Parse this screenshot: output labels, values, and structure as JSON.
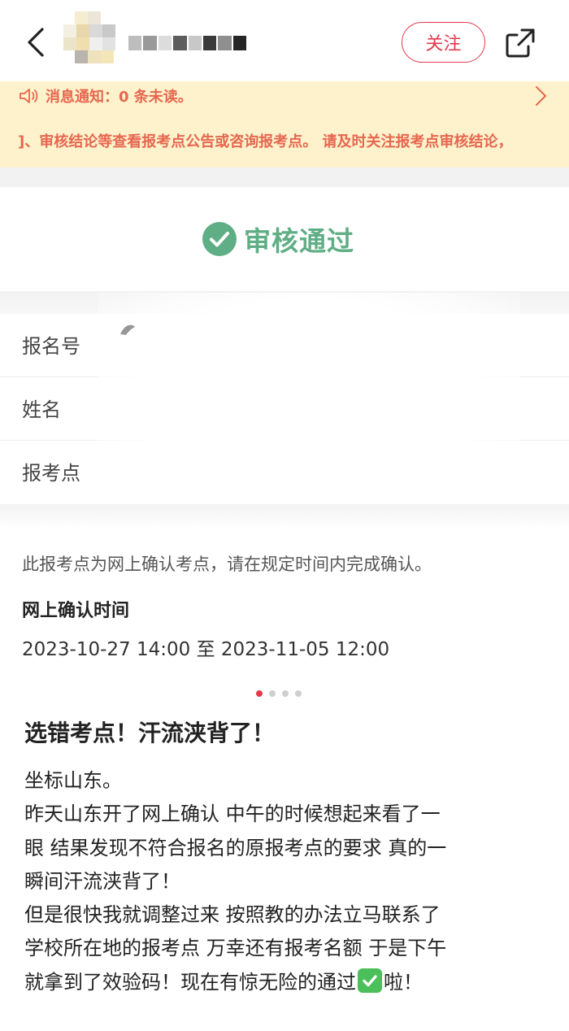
{
  "header": {
    "follow_label": "关注"
  },
  "notice": {
    "message": "消息通知：0 条未读。",
    "banner": "]、审核结论等查看报考点公告或咨询报考点。 请及时关注报考点审核结论，"
  },
  "status": {
    "text": "审核通过",
    "color": "#5fae85"
  },
  "info_rows": [
    {
      "label": "报名号"
    },
    {
      "label": "姓名"
    },
    {
      "label": "报考点"
    }
  ],
  "confirm": {
    "note": "此报考点为网上确认考点，请在规定时间内完成确认。",
    "title": "网上确认时间",
    "time": "2023-10-27 14:00 至 2023-11-05 12:00"
  },
  "carousel": {
    "total": 4,
    "active_index": 0
  },
  "post": {
    "title": "选错考点！汗流浃背了！",
    "lines": [
      "坐标山东。",
      "昨天山东开了网上确认 中午的时候想起来看了一",
      "眼 结果发现不符合报名的原报考点的要求 真的一",
      "瞬间汗流浃背了！",
      "但是很快我就调整过来 按照教的办法立马联系了",
      "学校所在地的报考点 万幸还有报考名额 于是下午"
    ],
    "last_line_before": "就拿到了效验码！现在有惊无险的通过",
    "last_line_after": "啦！"
  },
  "icons": {
    "back": "chevron-left-icon",
    "share": "share-icon",
    "speaker": "speaker-icon",
    "notice_arrow": "chevron-right-icon",
    "status": "check-circle-icon",
    "emoji": "check-mark-button-emoji"
  },
  "colors": {
    "accent": "#e23a4c",
    "notice_bg": "#fdf2cc",
    "notice_text": "#e6674f"
  }
}
